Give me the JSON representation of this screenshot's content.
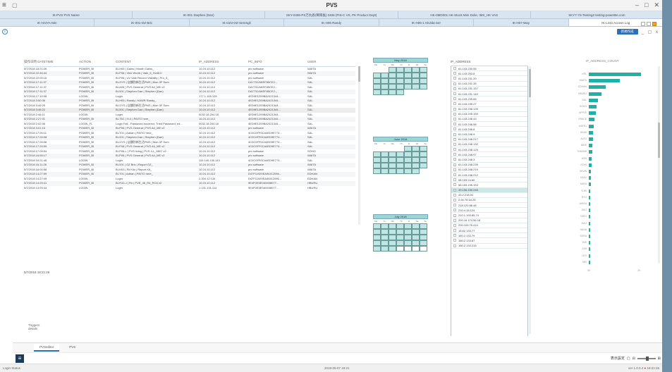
{
  "app": {
    "title": "PVS",
    "menu_icon": "hamburger-icon",
    "window_controls": [
      "minimize-icon",
      "maximize-icon",
      "close-icon"
    ]
  },
  "tabs_row1": [
    "IK-PVS PVS Name",
    "IK-001 Stephen (Dan)",
    "SKY-0406-PS万丸各(稀岡長) 0406 (PIS-C VS, PK Product Dept)",
    "HK-0MD001 HK-Stoc6 Mim Dolie, IMS_HK VAS",
    "SKY7-7S-Testing2 testing-powerBe.com"
  ],
  "tabs_row2": [
    {
      "label": "IK-HAIYA-Min",
      "active": false
    },
    {
      "label": "IK-001-OZ-Bric",
      "active": false
    },
    {
      "label": "IK-OZ3-OZ-Serengli",
      "active": false
    },
    {
      "label": "IK-H05 Randy",
      "active": false
    },
    {
      "label": "IK-H06-1 HiUlda-Ser",
      "active": false
    },
    {
      "label": "IK-H07-Way",
      "active": false
    },
    {
      "label": "IK-L242 Access Log",
      "active": true
    }
  ],
  "toolbar": {
    "new_label": "新規作成",
    "mini_controls": "_ ▢ x",
    "info_icon": "info-icon"
  },
  "table": {
    "columns": [
      "操作日時 DATETIME",
      "ACTION",
      "CONTENT",
      "IP_ADDRESS",
      "PC_INFO",
      "USER"
    ],
    "rows": [
      [
        "5/7/2018 18:21:26",
        "POWER_BI",
        "BI-H05 | Gains | Month Gains_",
        "10.24.10.112",
        "pro software",
        "WAITA"
      ],
      [
        "5/7/2018 22:46:44",
        "POWER_BI",
        "BI-P06 | Vine Worth | Vale_5_Hvd5.0",
        "10.24.10.112",
        "pro software",
        "WAITA"
      ],
      [
        "5/7/2018 22:00:16",
        "POWER_BI",
        "BI-P06 | UV Vale Record Visibility | Pro_5_",
        "10.24.10.112",
        "pro software",
        "SAL"
      ],
      [
        "5/7/2018 17:11:37",
        "POWER_BI",
        "BI-OYS | 店舗別新生活PMS | Mon 3F Sum",
        "10.24.10.112",
        "DA77314WEF85CE2...",
        "SAL"
      ],
      [
        "5/7/2018 17:11:37",
        "POWER_BI",
        "BI-A06 | PVS General | PVS A4_ME v2",
        "10.24.10.112",
        "DA77314WEF85CE2...",
        "SAL"
      ],
      [
        "5/7/2018 17:11:37",
        "POWER_BI",
        "BI-001 | Stephen Dan | Stephen (Dan)",
        "10.24.10.112",
        "DA77314WEF85CE2...",
        "SAL"
      ],
      [
        "5/7/2018 17:10:06",
        "LOGIN",
        "Login",
        "177.1.165.105",
        "4ED9E1209BA2421344...",
        "SAL"
      ],
      [
        "5/7/2018 3:50:36",
        "POWER_BI",
        "BI-H05 | Randy | HAWR Randy_",
        "10.24.10.112",
        "4ED9E1209BA2421344...",
        "SAL"
      ],
      [
        "5/7/2018 3:46:25",
        "POWER_BI",
        "BI-OYS | 店舗別新生活PMS | Mon 3F Sum",
        "10.24.10.112",
        "4ED9E1209BA2421344...",
        "SAL"
      ],
      [
        "5/7/2018 3:46:22",
        "POWER_BI",
        "BI-001 | Stephen Dan | Stephen (Dan)",
        "10.24.10.112",
        "4ED9E1209BA2421344...",
        "SAL"
      ],
      [
        "5/7/2018 2:46:11",
        "LOGIN",
        "Login",
        "0032.18.204.18",
        "4ED9E1209BA2421344...",
        "SAL"
      ],
      [
        "5/7/2018 2:27:01",
        "POWER_BI",
        "BI-T6C | H-4 | PAITO here_",
        "10.24.10.112",
        "4ED9E1209BA2421344...",
        "SAL"
      ],
      [
        "5/7/2018 2:02:06",
        "LOGIN_FL",
        "Login Fail - Password incorrect. Tried Password: ed...",
        "0032.18.204.18",
        "4ED9E1209BA2421344...",
        "SAL"
      ],
      [
        "5/7/2018 3:01:16",
        "POWER_BI",
        "BI-P06 | PVS General | PVS A4_ME v2",
        "10.24.10.112",
        "pro software",
        "WAITA"
      ],
      [
        "5/7/2018 17:26:11",
        "POWER_BI",
        "BI-T01 | Adrian | PAITO here_",
        "10.24.10.112",
        "4C0C0FF0CA4ED9E774...",
        "SAL"
      ],
      [
        "5/7/2018 17:26:08",
        "POWER_BI",
        "BI-001 | Stephen Dan | Stephen (Dan)",
        "10.24.10.112",
        "4C0C0FF0CA4ED9E774...",
        "SAL"
      ],
      [
        "5/7/2018 17:26:08",
        "POWER_BI",
        "BI-OYS | 店舗別新生活PMS | Mon 3F Sum",
        "10.24.10.112",
        "4C0C0FF0CA4ED9E774...",
        "SAL"
      ],
      [
        "5/7/2018 17:25:59",
        "POWER_BI",
        "BI-P06 | PVS General | PVS A4_ME v2",
        "10.24.10.112",
        "4C0C0FF0CA4ED9E774...",
        "SAL"
      ],
      [
        "5/7/2018 17:09:54",
        "POWER_BI",
        "BI-P06-L | PVS living | PVS 4-L_MEC v2",
        "10.24.10.112",
        "pro software",
        "SOHO"
      ],
      [
        "5/7/2018 16:55:17",
        "POWER_BI",
        "BI-P06 | PVS General | PVS A4_ME v2",
        "10.24.10.112",
        "pro software",
        "WAITA"
      ],
      [
        "5/7/2018 16:21:46",
        "LOGIN",
        "Login",
        "119.140.136.143",
        "4C0C0FF0CA4ED9E774...",
        "SAL"
      ],
      [
        "5/7/2018 16:11:28",
        "POWER_BI",
        "BI-001 | OZ Bric | Report OZ_",
        "10.24.10.112",
        "pro software",
        "WAITA"
      ],
      [
        "5/7/2018 16:00:58",
        "POWER_BI",
        "BI-H03 | Fit Kilo | Report Kit_",
        "10.24.10.112",
        "pro software",
        "WAITA"
      ],
      [
        "5/7/2018 14:27:59",
        "POWER_BI",
        "BI-T01 | Adrian | PAITO here_",
        "10.24.10.112",
        "D47F11920EA90412096...",
        "EDHAN"
      ],
      [
        "5/7/2018 14:27:49",
        "LOGIN",
        "Login",
        "2.104.12.134",
        "D47F11920EA90412096...",
        "EDHAN"
      ],
      [
        "5/7/2018 14:25:41",
        "POWER_BI",
        "BI-R10-J | Rn | PVE_46_R4_RO4 v2",
        "10.24.10.112",
        "9E4F0E5E0A9408077...",
        "HBURU"
      ],
      [
        "5/7/2018 14:03:44",
        "LOGIN",
        "Login",
        "1.131.131.114",
        "9E4F0E5E0A9408077...",
        "HBURU"
      ]
    ],
    "selected_row": 9,
    "end_label": "5/7/2018 18:21:26"
  },
  "calendars": [
    {
      "title": "May 2018",
      "days": [
        "Mo",
        "Tu",
        "We",
        "Th",
        "Fr",
        "Sa",
        "Su"
      ]
    },
    {
      "title": "June 2018",
      "days": [
        "Mo",
        "Tu",
        "We",
        "Th",
        "Fr",
        "Sa",
        "Su"
      ]
    },
    {
      "title": "July 2018",
      "days": [
        "Mo",
        "Tu",
        "We",
        "Th",
        "Fr",
        "Sa",
        "Su"
      ]
    }
  ],
  "ip_panel": {
    "header": "IP_ADDRESS",
    "items": [
      "61.143.230.55",
      "61.143.253.8",
      "61.143.231.20",
      "61.143.231.35",
      "61.143.231.157",
      "61.143.231.140",
      "61.143.235.65",
      "61.143.235.27",
      "61.143.236.139",
      "61.143.245.150",
      "61.143.246.43",
      "61.143.246.58",
      "61.143.246.8",
      "61.143.246.9",
      "61.143.246.217",
      "61.143.246.132",
      "61.143.248.125",
      "61.143.248.97",
      "61.143.248.3",
      "61.143.248.235",
      "61.143.248.219",
      "61.143.248.212",
      "58.153.24.80",
      "58.153.195.153",
      "49.156.150.246",
      "43.2.218.54",
      "2.94.75.54.25",
      "218.120.86.48",
      "210.4.18.124",
      "210.1.193.85.74",
      "200.16.174.56.18",
      "200.109.75.410",
      "18.62.133.77",
      "160.2.133.79",
      "160.2.133.87",
      "160.2.133.215"
    ],
    "selected_index": 24
  },
  "bar_chart": {
    "header": "IP_ADDRESS_COUNT",
    "tick_left": "0K",
    "tick_right": "2K"
  },
  "chart_data": {
    "type": "bar",
    "orientation": "horizontal",
    "title": "IP_ADDRESS_COUNT",
    "categories": [
      "KRL",
      "WAITA",
      "EDHAN",
      "HBURU",
      "SAL",
      "SOHO",
      "APPLE",
      "GRACE",
      "USER1",
      "HKAS",
      "ALEX",
      "MIKE",
      "TOMOMI",
      "KEN",
      "JOHN",
      "KEVIN",
      "KAZU",
      "MAYA",
      "YUKI",
      "RYO",
      "AKIRA",
      "SHO",
      "TARO",
      "NAO",
      "HANA",
      "SORA",
      "EMI",
      "JUN",
      "LEO",
      "MEI"
    ],
    "values": [
      2180,
      1280,
      700,
      520,
      380,
      330,
      290,
      240,
      210,
      180,
      165,
      150,
      140,
      125,
      110,
      100,
      90,
      80,
      70,
      60,
      55,
      50,
      45,
      40,
      35,
      30,
      25,
      20,
      15,
      10
    ],
    "xlim": [
      0,
      2200
    ],
    "xticks": [
      "0K",
      "2K"
    ],
    "color": "#23B0A4"
  },
  "footer": {
    "left_note_1": "Triggers",
    "left_note_2": "details",
    "tabs": [
      {
        "label": "PVSeditor",
        "active": true
      },
      {
        "label": "PVS",
        "active": false
      }
    ],
    "nav_icon": "list-icon",
    "right_text": "表示設定",
    "zoom_minus": "⊟",
    "zoom_plus": "⊞"
  },
  "status": {
    "left": "Login Status",
    "middle": "2018-05-07 18:21",
    "right_prefix": "ver 1.0.0.4",
    "right_alert": "●",
    "right_suffix": "18:21:26"
  },
  "colors": {
    "accent": "#2A6FB8",
    "teal": "#23B0A4",
    "calendar": "#BFE6E2"
  }
}
